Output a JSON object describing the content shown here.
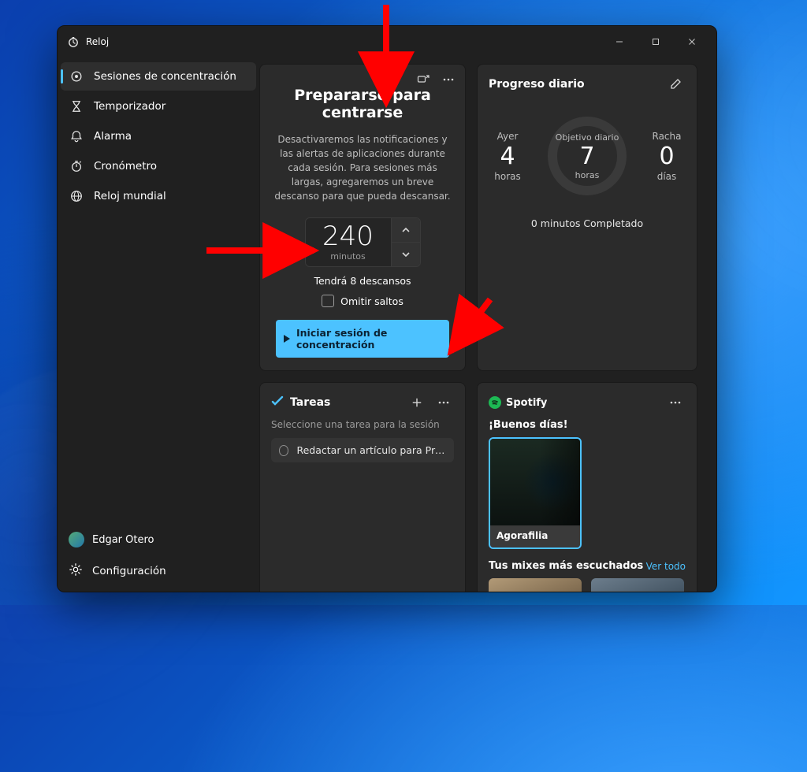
{
  "app": {
    "title": "Reloj"
  },
  "window_controls": {
    "minimize": "minimize",
    "maximize": "maximize",
    "close": "close"
  },
  "sidebar": {
    "items": [
      {
        "id": "focus",
        "label": "Sesiones de concentración",
        "icon": "focus-target-icon"
      },
      {
        "id": "timer",
        "label": "Temporizador",
        "icon": "hourglass-icon"
      },
      {
        "id": "alarm",
        "label": "Alarma",
        "icon": "bell-icon"
      },
      {
        "id": "stopwatch",
        "label": "Cronómetro",
        "icon": "stopwatch-icon"
      },
      {
        "id": "world",
        "label": "Reloj mundial",
        "icon": "globe-icon"
      }
    ],
    "selected_id": "focus"
  },
  "account": {
    "name": "Edgar Otero"
  },
  "settings_label": "Configuración",
  "focus": {
    "title": "Prepararse para centrarse",
    "description": "Desactivaremos las notificaciones y las alertas de aplicaciones durante cada sesión. Para sesiones más largas, agregaremos un breve descanso para que pueda descansar.",
    "duration_value": "240",
    "duration_unit": "minutos",
    "breaks_text": "Tendrá 8 descansos",
    "skip_label": "Omitir saltos",
    "start_label": "Iniciar sesión de concentración"
  },
  "progress": {
    "title": "Progreso diario",
    "ayer": {
      "label": "Ayer",
      "value": "4",
      "unit": "horas"
    },
    "goal": {
      "label": "Objetivo diario",
      "value": "7",
      "unit": "horas"
    },
    "streak": {
      "label": "Racha",
      "value": "0",
      "unit": "días"
    },
    "footer": "0 minutos Completado"
  },
  "tasks": {
    "title": "Tareas",
    "subtitle": "Seleccione una tarea para la sesión",
    "items": [
      {
        "text": "Redactar un artículo para Profesi..."
      }
    ]
  },
  "spotify": {
    "brand": "Spotify",
    "greeting": "¡Buenos días!",
    "featured": {
      "title": "Agorafilia"
    },
    "mixes_title": "Tus mixes más escuchados",
    "see_all": "Ver todo"
  },
  "colors": {
    "accent": "#4cc2ff",
    "arrow": "#ff0000"
  }
}
